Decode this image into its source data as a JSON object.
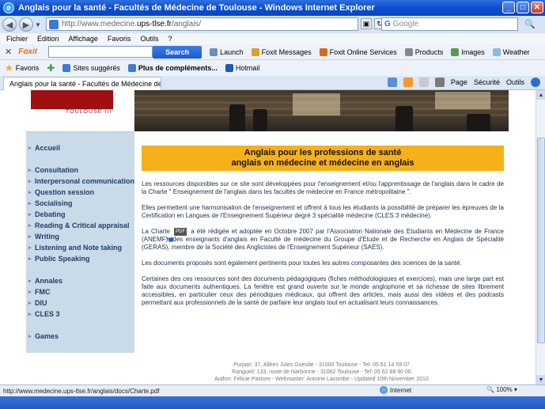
{
  "window": {
    "title": "Anglais pour la santé - Facultés de Médecine de Toulouse - Windows Internet Explorer",
    "minimize": "_",
    "maximize": "□",
    "close": "✕"
  },
  "address": {
    "prefix": "http://www.medecine.",
    "domain": "ups-tlse.fr",
    "path": "/anglais/",
    "search_placeholder": "Google",
    "search_go": "🔍"
  },
  "menu": [
    "Fichier",
    "Edition",
    "Affichage",
    "Favoris",
    "Outils",
    "?"
  ],
  "foxit": {
    "close": "✕",
    "logo": "Foxit",
    "search": "Search",
    "items": [
      "Launch",
      "Foxit Messages",
      "Foxit Online Services",
      "Products",
      "Images",
      "Weather"
    ]
  },
  "favorites": {
    "label": "Favoris",
    "items": [
      "Sites suggérés",
      "Plus de compléments...",
      "Hotmail"
    ]
  },
  "tab": {
    "title": "Anglais pour la santé - Facultés de Médecine de Toulo..."
  },
  "cmdbar": [
    "Page",
    "Sécurité",
    "Outils"
  ],
  "logo": {
    "subtitle": "TOULOUSE III"
  },
  "nav": {
    "top": "Accueil",
    "group1": [
      "Consultation",
      "Interpersonal communication",
      "Question session",
      "Socialising",
      "Debating",
      "Reading & Critical appraisal",
      "Writing",
      "Listening and Note taking",
      "Public Speaking"
    ],
    "group2": [
      "Annales",
      "FMC",
      "DIU",
      "CLES 3"
    ],
    "bottom": "Games"
  },
  "hero": {
    "line1": "Anglais pour les professions de santé",
    "line2": "anglais en médecine et médecine en anglais"
  },
  "paragraphs": {
    "p1": "Les ressources disponibles sur ce site sont développées pour l'enseignement et/ou l'apprentissage de l'anglais dans le cadre de la Charte \" Enseignement de l'anglais dans les facultés de médecine en France métropolitaine \".",
    "p2": "Elles permettent une harmonisation de l'enseignement et offrent à tous les étudiants la possibilité de préparer les épreuves de la Certification en Langues de l'Enseignement Supérieur degré 3 spécialité médecine (CLES 3 médecine).",
    "p3_before": "La Charte",
    "p3_pdf": "PDF",
    "p3_after": "a été rédigée et adoptée en Octobre 2007 par l'Association Nationale des Etudiants en Médecine de France (ANEMF), des enseignants d'anglais en Faculté de médecine du Groupe d'Etude et de Recherche en Anglais de Spécialité (GERAS), membre de la Société des Anglicistes de l'Enseignement Supérieur (SAES).",
    "p4": "Les documents proposés sont également pertinents pour toutes les autres composantes des sciences de la santé.",
    "p5": "Certaines des ces ressources sont des documents pédagogiques (fiches méthodologiques et exercices), mais une large part est faite aux documents authentiques. La fenêtre est grand ouverte sur le monde anglophone et sa richesse de sites librement accessibles, en particulier ceux des périodiques médicaux, qui offrent des articles, mais aussi des vidéos et des podcasts permettant aux professionnels de la santé de parfaire leur anglais tout en actualisant leurs connaissances."
  },
  "footer": {
    "line1": "Purpan: 37, Allées Jules Guesde - 31000 Toulouse - Tel: 05 61 14 59 07",
    "line2": "Rangueil: 133, route de Narbonne - 31062 Toulouse - Tel: 05 62 88 90 00",
    "line3": "Author: Félicie Pastore   -   Webmaster: Antoine Lacombe   -   Updated 10th November 2010"
  },
  "status": {
    "url": "http://www.medecine.ups-tlse.fr/anglais/docs/Charte.pdf",
    "zone": "Internet",
    "zoom": "100%"
  }
}
